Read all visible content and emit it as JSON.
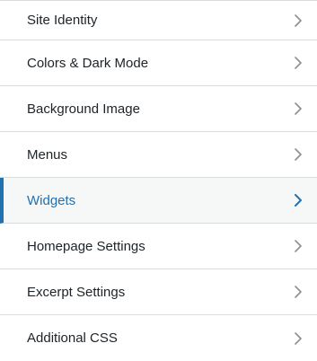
{
  "customizer": {
    "items": [
      {
        "label": "Site Identity",
        "active": false,
        "icon": "chevron-right-icon"
      },
      {
        "label": "Colors & Dark Mode",
        "active": false,
        "icon": "chevron-right-icon"
      },
      {
        "label": "Background Image",
        "active": false,
        "icon": "chevron-right-icon"
      },
      {
        "label": "Menus",
        "active": false,
        "icon": "chevron-right-icon"
      },
      {
        "label": "Widgets",
        "active": true,
        "icon": "chevron-right-icon"
      },
      {
        "label": "Homepage Settings",
        "active": false,
        "icon": "chevron-right-icon"
      },
      {
        "label": "Excerpt Settings",
        "active": false,
        "icon": "chevron-right-icon"
      },
      {
        "label": "Additional CSS",
        "active": false,
        "icon": "chevron-right-icon"
      }
    ]
  },
  "colors": {
    "accent": "#2271b1",
    "text": "#1d2327",
    "chevron": "#8c8f94",
    "divider": "#dcdcde",
    "active_background": "#f6f7f7"
  }
}
